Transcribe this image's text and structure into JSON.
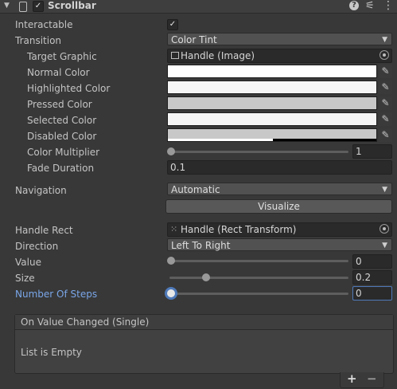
{
  "header": {
    "title": "Scrollbar",
    "enabled": "✓",
    "icons": [
      "help-icon",
      "preset-icon",
      "context-menu-icon"
    ]
  },
  "fields": {
    "interactable_label": "Interactable",
    "interactable_check": "✓",
    "transition_label": "Transition",
    "transition_value": "Color Tint",
    "target_graphic_label": "Target Graphic",
    "target_graphic_value": "Handle (Image)",
    "normal_color_label": "Normal Color",
    "highlighted_color_label": "Highlighted Color",
    "pressed_color_label": "Pressed Color",
    "selected_color_label": "Selected Color",
    "disabled_color_label": "Disabled Color",
    "color_multiplier_label": "Color Multiplier",
    "color_multiplier_value": "1",
    "fade_duration_label": "Fade Duration",
    "fade_duration_value": "0.1",
    "navigation_label": "Navigation",
    "navigation_value": "Automatic",
    "visualize_label": "Visualize",
    "handle_rect_label": "Handle Rect",
    "handle_rect_value": "Handle (Rect Transform)",
    "direction_label": "Direction",
    "direction_value": "Left To Right",
    "value_label": "Value",
    "value_value": "0",
    "size_label": "Size",
    "size_value": "0.2",
    "steps_label": "Number Of Steps",
    "steps_value": "0"
  },
  "sliders": {
    "color_multiplier": 0,
    "value": 0,
    "size": 0.2,
    "steps": 0
  },
  "colors": {
    "normal": "#ffffff",
    "highlighted": "#f5f5f5",
    "pressed": "#c8c8c8",
    "selected": "#f5f5f5",
    "disabled": "#c8c8c8",
    "accent": "#7aa6e8"
  },
  "event": {
    "title": "On Value Changed (Single)",
    "empty_text": "List is Empty",
    "add_label": "+",
    "remove_label": "−"
  }
}
